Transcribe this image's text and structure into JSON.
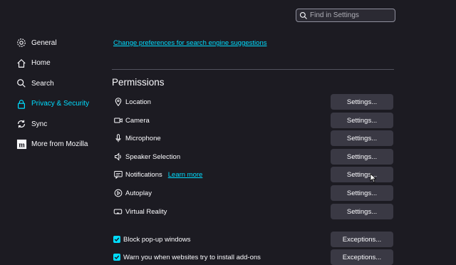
{
  "search": {
    "placeholder": "Find in Settings"
  },
  "sidebar": {
    "items": [
      {
        "label": "General",
        "icon": "gear-icon"
      },
      {
        "label": "Home",
        "icon": "home-icon"
      },
      {
        "label": "Search",
        "icon": "search-icon"
      },
      {
        "label": "Privacy & Security",
        "icon": "lock-icon",
        "active": true
      },
      {
        "label": "Sync",
        "icon": "sync-icon"
      },
      {
        "label": "More from Mozilla",
        "icon": "mozilla-icon"
      }
    ]
  },
  "top_link": "Change preferences for search engine suggestions",
  "permissions": {
    "title": "Permissions",
    "rows": [
      {
        "label": "Location",
        "icon": "location-icon",
        "button": "Settings..."
      },
      {
        "label": "Camera",
        "icon": "camera-icon",
        "button": "Settings..."
      },
      {
        "label": "Microphone",
        "icon": "microphone-icon",
        "button": "Settings..."
      },
      {
        "label": "Speaker Selection",
        "icon": "speaker-icon",
        "button": "Settings..."
      },
      {
        "label": "Notifications",
        "icon": "notification-icon",
        "link": "Learn more",
        "button": "Settings..."
      },
      {
        "label": "Autoplay",
        "icon": "autoplay-icon",
        "button": "Settings..."
      },
      {
        "label": "Virtual Reality",
        "icon": "vr-icon",
        "button": "Settings..."
      }
    ],
    "checkboxes": [
      {
        "label": "Block pop-up windows",
        "checked": true,
        "button": "Exceptions..."
      },
      {
        "label": "Warn you when websites try to install add-ons",
        "checked": true,
        "button": "Exceptions..."
      }
    ]
  },
  "colors": {
    "accent": "#00ddff",
    "background": "#1c1b22",
    "button": "#3a3944"
  }
}
